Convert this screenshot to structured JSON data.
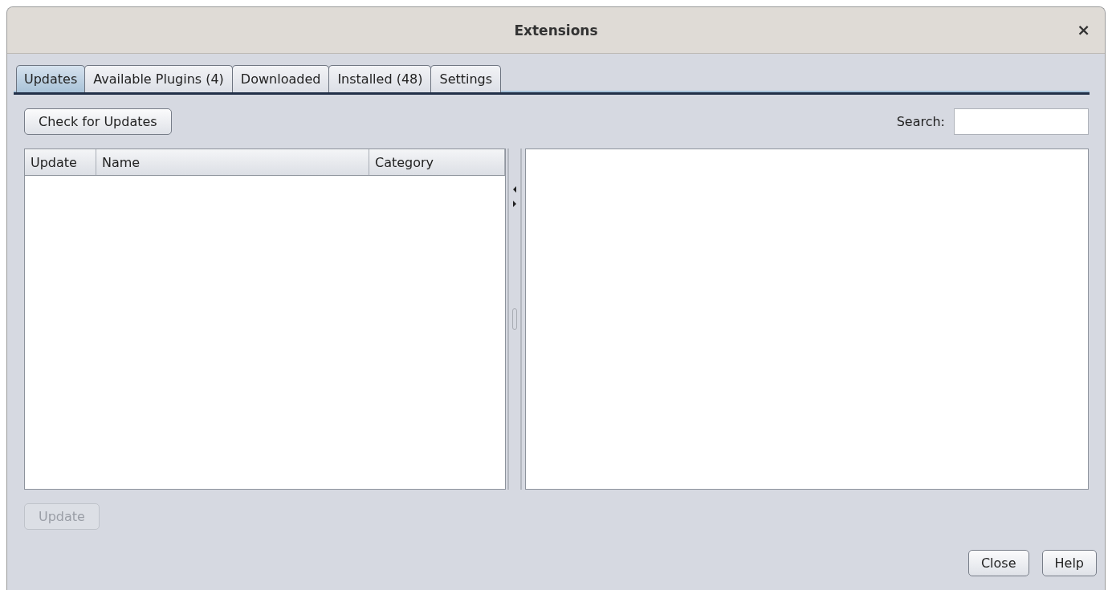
{
  "window": {
    "title": "Extensions",
    "close": "×"
  },
  "tabs": [
    {
      "label": "Updates",
      "selected": true
    },
    {
      "label": "Available Plugins (4)",
      "selected": false
    },
    {
      "label": "Downloaded",
      "selected": false
    },
    {
      "label": "Installed (48)",
      "selected": false
    },
    {
      "label": "Settings",
      "selected": false
    }
  ],
  "check_button": {
    "label": "Check for Updates",
    "disabled": false
  },
  "search": {
    "label": "Search:"
  },
  "table": {
    "columns": [
      "Update",
      "Name",
      "Category"
    ]
  },
  "update_button": {
    "label": "Update",
    "disabled": true
  },
  "buttons": [
    {
      "label": "Close"
    },
    {
      "label": "Help"
    }
  ]
}
